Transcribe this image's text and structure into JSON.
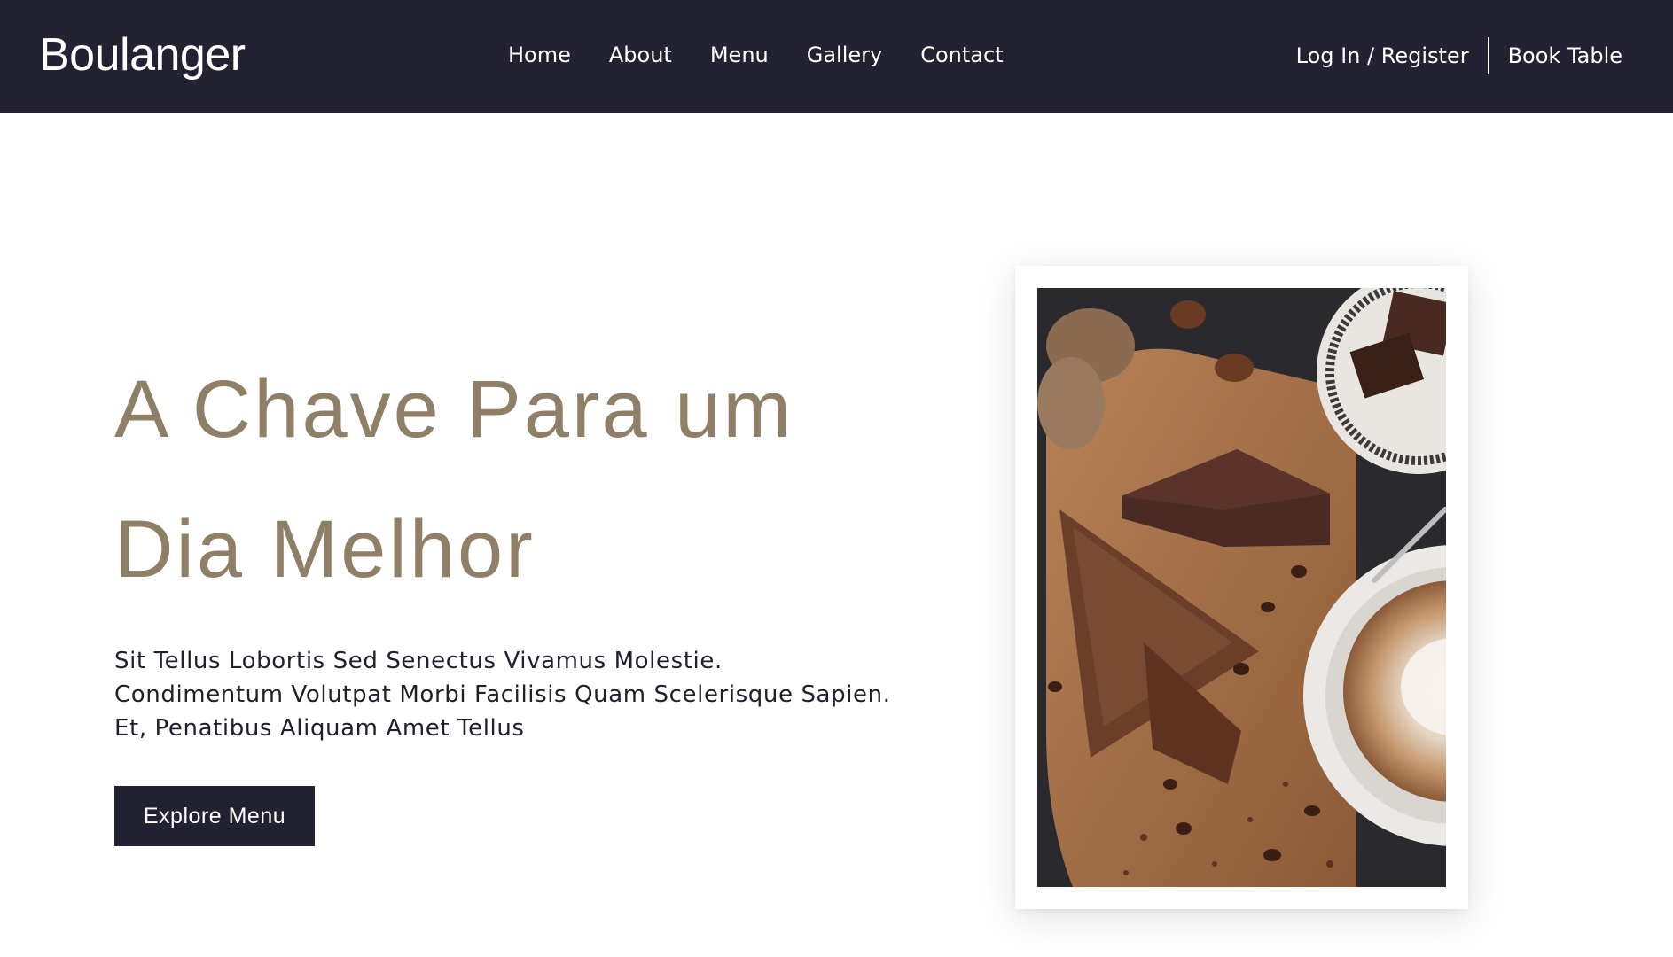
{
  "header": {
    "brand": "Boulanger",
    "nav": [
      "Home",
      "About",
      "Menu",
      "Gallery",
      "Contact"
    ],
    "login_label": "Log In / Register",
    "book_label": "Book Table"
  },
  "hero": {
    "title_line1": "A Chave Para um",
    "title_line2": "Dia Melhor",
    "text": "Sit Tellus Lobortis Sed Senectus Vivamus Molestie. Condimentum Volutpat Morbi Facilisis Quam Scelerisque Sapien. Et, Penatibus Aliquam Amet Tellus",
    "cta_label": "Explore Menu",
    "image_description_icon": "coffee-and-brownie-photo"
  },
  "colors": {
    "nav_bg": "#222233",
    "title": "#8f7f66",
    "body_text": "#1f1f2e",
    "button_bg": "#222233"
  }
}
